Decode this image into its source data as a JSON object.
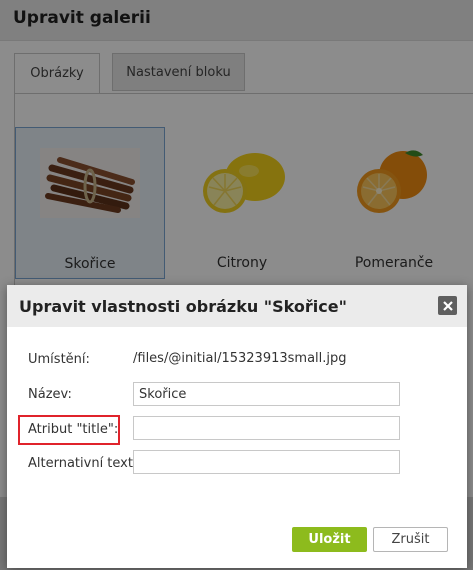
{
  "window": {
    "title": "Upravit galerii"
  },
  "tabs": [
    {
      "label": "Obrázky",
      "active": true
    },
    {
      "label": "Nastavení bloku",
      "active": false
    }
  ],
  "gallery": [
    {
      "caption": "Skořice",
      "selected": true,
      "image": "cinnamon-sticks"
    },
    {
      "caption": "Citrony",
      "selected": false,
      "image": "lemons"
    },
    {
      "caption": "Pomeranče",
      "selected": false,
      "image": "oranges"
    }
  ],
  "dialog": {
    "title": "Upravit vlastnosti obrázku \"Skořice\"",
    "close_icon": "close-icon",
    "fields": {
      "location": {
        "label": "Umístění:",
        "value": "/files/@initial/15323913small.jpg"
      },
      "name": {
        "label": "Název:",
        "value": "Skořice",
        "placeholder": ""
      },
      "title_attr": {
        "label": "Atribut \"title\":",
        "value": "",
        "placeholder": ""
      },
      "alt_text": {
        "label": "Alternativní text:",
        "value": "",
        "placeholder": ""
      }
    },
    "buttons": {
      "save": "Uložit",
      "cancel": "Zrušit"
    }
  },
  "colors": {
    "save_button": "#8dbb1d",
    "highlight": "#e0232b",
    "selection": "#7aa7d4"
  }
}
